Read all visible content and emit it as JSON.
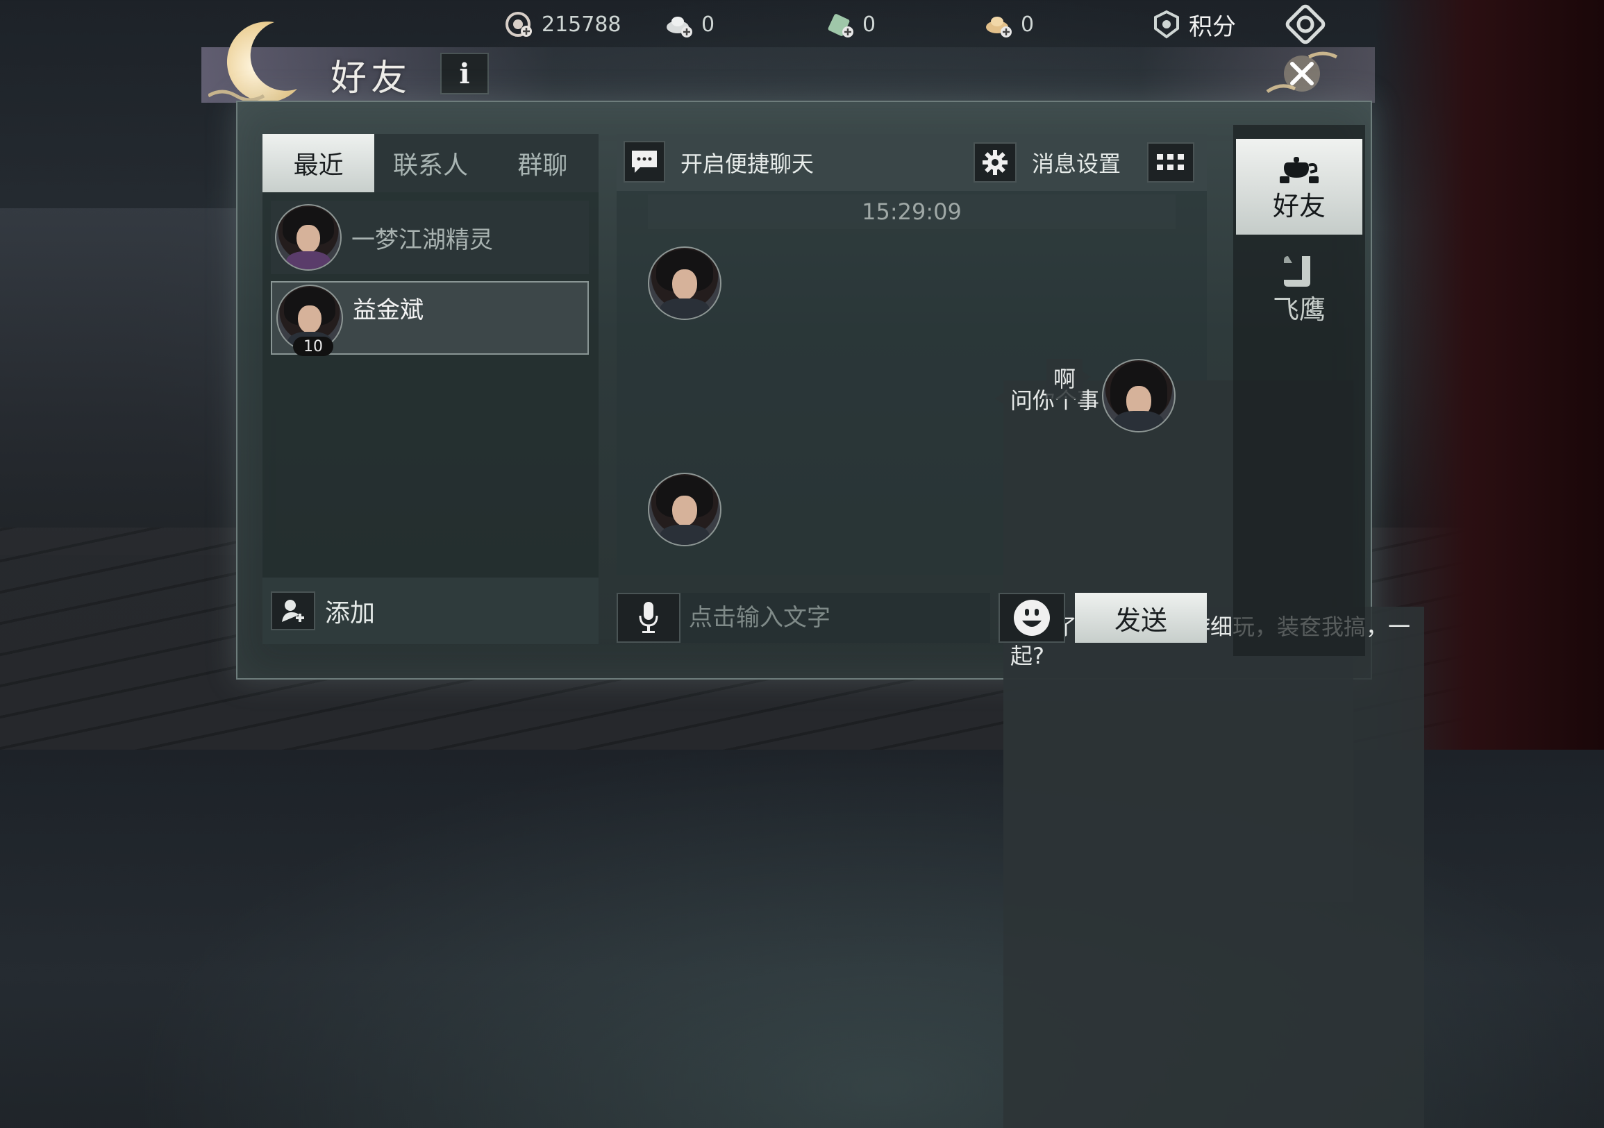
{
  "topbar": {
    "coins": "215788",
    "item1": "0",
    "item2": "0",
    "item3": "0",
    "points_label": "积分"
  },
  "window": {
    "title": "好友",
    "info_label": "i"
  },
  "tabs": [
    "最近",
    "联系人",
    "群聊"
  ],
  "conversations": [
    {
      "name": "一梦江湖精灵",
      "badge": ""
    },
    {
      "name": "益金斌",
      "badge": "10"
    }
  ],
  "add_label": "添加",
  "chat": {
    "quick_chat_label": "开启便捷聊天",
    "msg_settings_label": "消息设置",
    "timestamp": "15:29:09",
    "messages": [
      {
        "side": "left",
        "text": "问你个事"
      },
      {
        "side": "right",
        "text": "啊"
      },
      {
        "side": "left",
        "text": "我喊了点仁，焕个游细玩，装奁我搞，一起?"
      }
    ],
    "input_placeholder": "点击输入文字",
    "send_label": "发送"
  },
  "nav": [
    {
      "label": "好友",
      "icon": "teapot-icon",
      "active": true
    },
    {
      "label": "飞鹰",
      "icon": "scroll-icon",
      "active": false
    }
  ],
  "colors": {
    "active_tab": "#e3e8e5",
    "panel": "#2e3a3b"
  }
}
